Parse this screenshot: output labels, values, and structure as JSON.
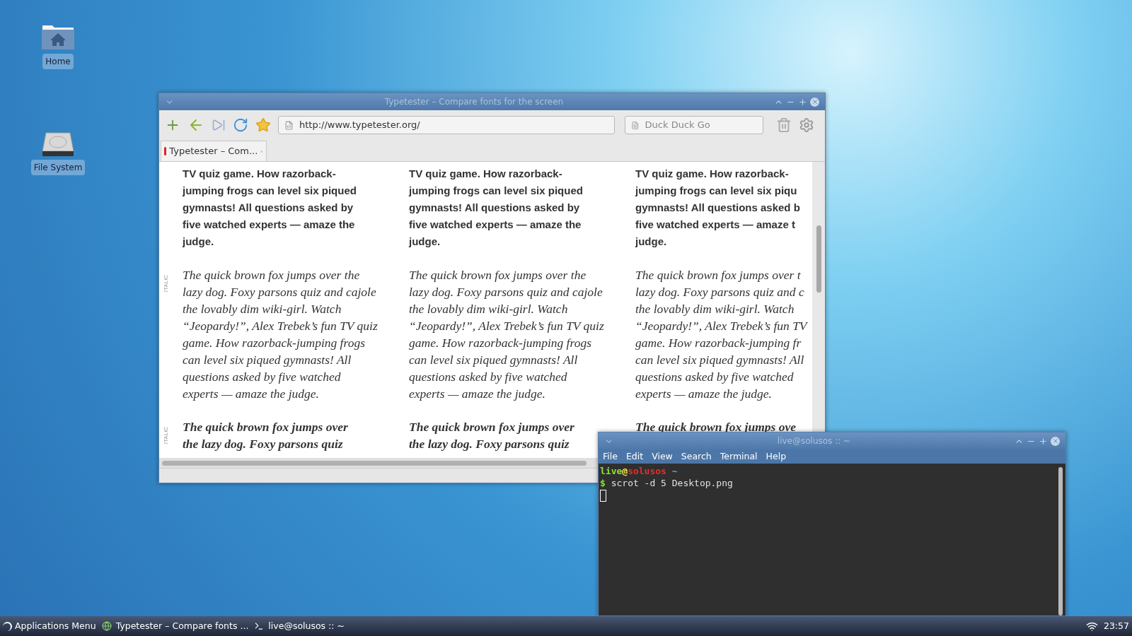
{
  "desktop_icons": [
    {
      "label": "Home",
      "kind": "folder"
    },
    {
      "label": "File System",
      "kind": "drive"
    }
  ],
  "browser": {
    "title": "Typetester – Compare fonts for the screen",
    "url": "http://www.typetester.org/",
    "search": {
      "placeholder": "Duck Duck Go"
    },
    "tabs": [
      {
        "label": "Typetester – Com...",
        "selected": true
      }
    ],
    "sections": [
      {
        "kind": "bold",
        "columns": [
          [
            "TV quiz game. How razorback-",
            "jumping frogs can level six piqued",
            "gymnasts! All questions asked by",
            "five watched experts — amaze the",
            "judge."
          ],
          [
            "TV quiz game. How razorback-",
            "jumping frogs can level six piqued",
            "gymnasts! All questions asked by",
            "five watched experts — amaze the",
            "judge."
          ],
          [
            "TV quiz game. How razorback-",
            "jumping frogs can level six piqu",
            "gymnasts! All questions asked b",
            "five watched experts — amaze t",
            "judge."
          ]
        ]
      },
      {
        "kind": "italic",
        "side_label": "ITALIC",
        "columns": [
          [
            "The quick brown fox jumps over the",
            "lazy dog. Foxy parsons quiz and cajole",
            "the lovably dim wiki-girl. Watch",
            "“Jeopardy!”, Alex Trebek’s fun TV quiz",
            "game. How razorback-jumping frogs",
            "can level six piqued gymnasts! All",
            "questions asked by five watched",
            "experts — amaze the judge."
          ],
          [
            "The quick brown fox jumps over the",
            "lazy dog. Foxy parsons quiz and cajole",
            "the lovably dim wiki-girl. Watch",
            "“Jeopardy!”, Alex Trebek’s fun TV quiz",
            "game. How razorback-jumping frogs",
            "can level six piqued gymnasts! All",
            "questions asked by five watched",
            "experts — amaze the judge."
          ],
          [
            "The quick brown fox jumps over t",
            "lazy dog. Foxy parsons quiz and c",
            "the lovably dim wiki-girl. Watch",
            "“Jeopardy!”, Alex Trebek’s fun TV",
            "game. How razorback-jumping fr",
            "can level six piqued gymnasts! All",
            "questions asked by five watched",
            "experts — amaze the judge."
          ]
        ]
      },
      {
        "kind": "bold_italic",
        "side_label": "ITALIC",
        "columns": [
          [
            "The quick brown fox jumps over",
            "the lazy dog. Foxy parsons quiz"
          ],
          [
            "The quick brown fox jumps over",
            "the lazy dog. Foxy parsons quiz"
          ],
          [
            "The quick brown fox jumps ove"
          ]
        ]
      }
    ]
  },
  "terminal": {
    "title": "live@solusos :: ~",
    "menu": [
      "File",
      "Edit",
      "View",
      "Search",
      "Terminal",
      "Help"
    ],
    "prompt": {
      "user": "live",
      "at": "@",
      "host": "solusos",
      "path": "~"
    },
    "command_line": {
      "sign": "$",
      "command": "scrot -d 5 Desktop.png"
    }
  },
  "taskbar": {
    "menu_label": "Applications Menu",
    "tasks": [
      {
        "label": "Typetester – Compare fonts ...",
        "kind": "browser"
      },
      {
        "label": "live@solusos :: ~",
        "kind": "terminal"
      }
    ],
    "clock": "23:57"
  }
}
